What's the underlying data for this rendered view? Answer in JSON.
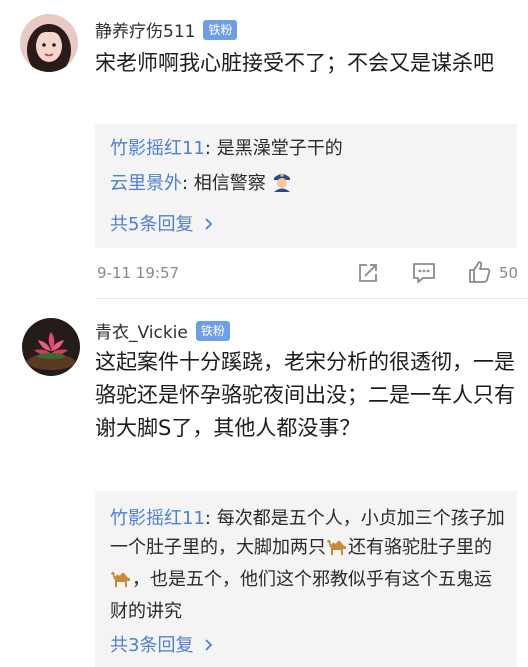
{
  "comments": [
    {
      "username": "静养疗伤511",
      "badge": "铁粉",
      "content": "宋老师啊我心脏接受不了；不会又是谋杀吧",
      "replies": [
        {
          "author": "竹影摇红11",
          "sep": ": ",
          "text": "是黑澡堂子干的"
        },
        {
          "author": "云里景外",
          "sep": ": ",
          "text": "相信警察"
        }
      ],
      "reply_emoji": "police-officer-emoji",
      "more_label": "共5条回复",
      "time": "9-11 19:57",
      "likes": "50"
    },
    {
      "username": "青衣_Vickie",
      "badge": "铁粉",
      "content": "这起案件十分蹊跷，老宋分析的很透彻，一是骆驼还是怀孕骆驼夜间出没；二是一车人只有谢大脚S了，其他人都没事？",
      "replies": [
        {
          "author": "竹影摇红11",
          "sep": ": ",
          "text1": "每次都是五个人，小贞加三个孩子加一个肚子里的，大脚加两只",
          "text2": "还有骆驼肚子里的",
          "text3": "，也是五个，他们这个邪教似乎有这个五鬼运财的讲究"
        }
      ],
      "reply_emoji": "camel-emoji",
      "more_label": "共3条回复"
    }
  ],
  "icons": {
    "share": "share-icon",
    "comment": "comment-icon",
    "like": "thumbs-up-icon",
    "more_chevron": "chevron-right-icon"
  },
  "colors": {
    "link": "#4d7fd2",
    "badge": "#6d9ee6",
    "reply_bg": "#f4f4f4",
    "meta": "#8a8a8a"
  }
}
